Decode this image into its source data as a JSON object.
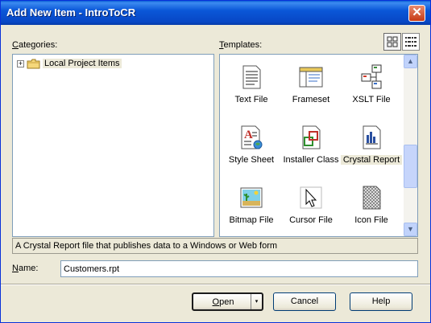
{
  "window": {
    "title": "Add New Item - IntroToCR",
    "close_glyph": "✕"
  },
  "categories": {
    "label": "ategories:",
    "label_accel": "C",
    "items": [
      {
        "label": "Local Project Items",
        "expander": "+",
        "icon": "folder-icon"
      }
    ]
  },
  "templates": {
    "label": "emplates:",
    "label_accel": "T",
    "view_buttons": [
      "large-icons-view-icon",
      "small-icons-view-icon"
    ],
    "items": [
      {
        "label": "Text File",
        "icon": "text-file-icon",
        "selected": false
      },
      {
        "label": "Frameset",
        "icon": "frameset-icon",
        "selected": false
      },
      {
        "label": "XSLT File",
        "icon": "xslt-file-icon",
        "selected": false
      },
      {
        "label": "Style Sheet",
        "icon": "style-sheet-icon",
        "selected": false
      },
      {
        "label": "Installer Class",
        "icon": "installer-class-icon",
        "selected": false
      },
      {
        "label": "Crystal Report",
        "icon": "crystal-report-icon",
        "selected": true
      },
      {
        "label": "Bitmap File",
        "icon": "bitmap-file-icon",
        "selected": false
      },
      {
        "label": "Cursor File",
        "icon": "cursor-file-icon",
        "selected": false
      },
      {
        "label": "Icon File",
        "icon": "icon-file-icon",
        "selected": false
      }
    ]
  },
  "description": "A Crystal Report file that publishes data to a Windows or Web form",
  "name_field": {
    "label": "ame:",
    "label_accel": "N",
    "value": "Customers.rpt"
  },
  "buttons": {
    "open": {
      "label": "pen",
      "accel": "O",
      "split_glyph": "▾"
    },
    "cancel": "Cancel",
    "help": "Help"
  },
  "scrollbar": {
    "up_glyph": "▲",
    "down_glyph": "▼"
  },
  "colors": {
    "title_bar": "#0a57d8",
    "dialog_bg": "#ece9d8",
    "panel_border": "#7f9db9",
    "close_button": "#c73a14"
  }
}
